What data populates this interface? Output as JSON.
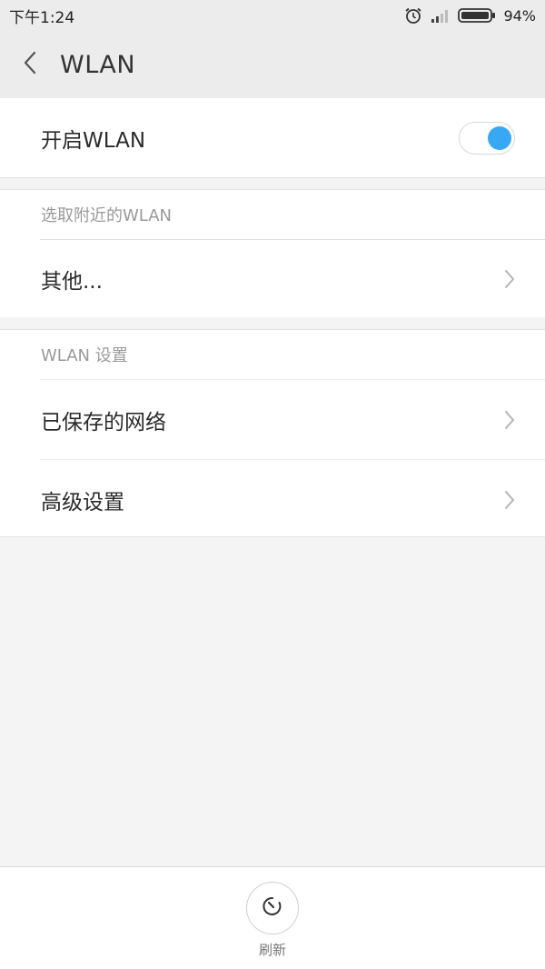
{
  "status_bar": {
    "time": "下午1:24",
    "battery_percent_text": "94%",
    "battery_level": 0.94,
    "icons": [
      "alarm-icon",
      "signal-icon",
      "battery-icon"
    ]
  },
  "header": {
    "title": "WLAN",
    "back_icon": "back-arrow-icon"
  },
  "wlan_toggle": {
    "label": "开启WLAN",
    "enabled": true,
    "accent_color": "#38a8f5"
  },
  "nearby": {
    "section_title": "选取附近的WLAN",
    "items": [
      {
        "label": "其他..."
      }
    ]
  },
  "settings": {
    "section_title": "WLAN 设置",
    "items": [
      {
        "label": "已保存的网络"
      },
      {
        "label": "高级设置"
      }
    ]
  },
  "bottom": {
    "refresh_label": "刷新",
    "refresh_icon": "refresh-icon"
  }
}
